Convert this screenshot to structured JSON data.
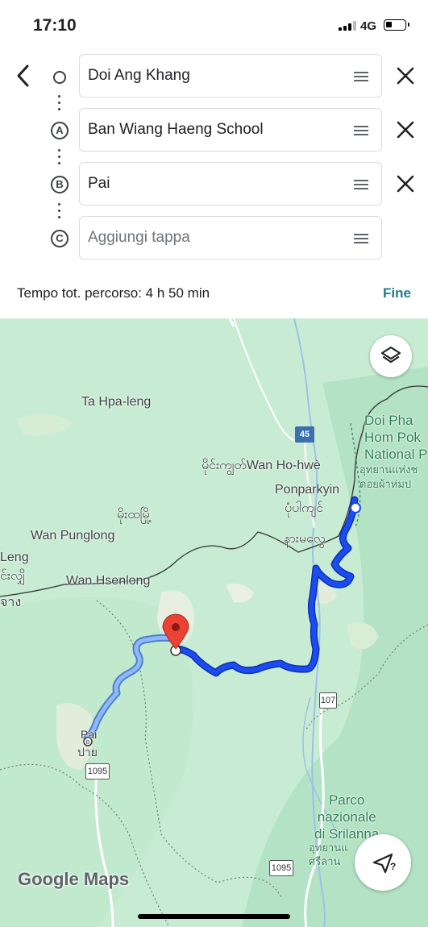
{
  "status": {
    "time": "17:10",
    "network": "4G"
  },
  "route": {
    "stops": [
      {
        "marker": "",
        "value": "Doi Ang Khang",
        "placeholder": ""
      },
      {
        "marker": "A",
        "value": "Ban Wiang Haeng School",
        "placeholder": ""
      },
      {
        "marker": "B",
        "value": "Pai",
        "placeholder": ""
      },
      {
        "marker": "C",
        "value": "",
        "placeholder": "Aggiungi tappa"
      }
    ],
    "summary": "Tempo tot. percorso: 4 h 50 min",
    "done_label": "Fine"
  },
  "map": {
    "labels": {
      "ta_hpa_leng": "Ta Hpa-leng",
      "wan_ho_hwe": "မိုင်းကျွတ်Wan Ho-hwè",
      "ponparkyin": "Ponparkyin",
      "ponparkyin_local": "ပုံပါကျင်",
      "namalwe": "နားမလွေ",
      "mong_htoo": "မိုးထမြို့",
      "wan_punglong": "Wan Punglong",
      "leng": "Leng",
      "leng_local": "င်းလျှိ",
      "wan_hsenlong": "Wan Hsenlong",
      "jang": "จาง",
      "pai": "Pai",
      "pai_local": "ปาย",
      "doi_pha_hom_pok": "Doi Pha\nHom Pok\nNational P",
      "doi_pha_hom_pok_thai": "อุทยานแห่งช\nดอยผ้าห่มป",
      "srilanna": "Parco\nnazionale\ndi Srilanna",
      "srilanna_thai": "อุทยานแ\nศรีลาน"
    },
    "shields": {
      "r45": "45",
      "r107": "107",
      "r1095a": "1095",
      "r1095b": "1095"
    },
    "attribution": "Google Maps",
    "route_color": "#1a4cf0",
    "alt_route_color": "#7aaaf5"
  }
}
